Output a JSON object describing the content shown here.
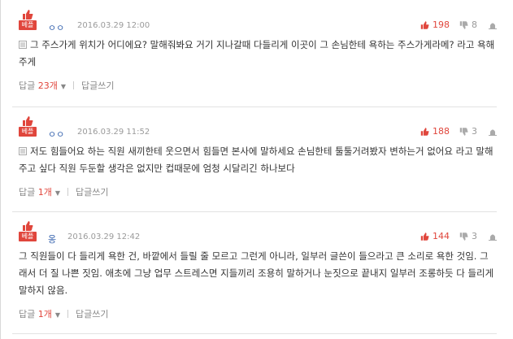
{
  "comments": [
    {
      "badge": "베플",
      "author": "ㅇㅇ",
      "date": "2016.03.29 12:00",
      "up": "198",
      "down": "8",
      "text": "그 주스가게 위치가 어디에요? 말해줘봐요 거기 지나갈때 다들리게 이곳이 그 손님한테 욕하는 주스가게라메? 라고 욕해주게",
      "reply_label": "답글",
      "reply_count": "23개",
      "write_label": "답글쓰기"
    },
    {
      "badge": "베플",
      "author": "ㅇㅇ",
      "date": "2016.03.29 11:52",
      "up": "188",
      "down": "3",
      "text": "저도 힘들어요 하는 직원 새끼한테 웃으면서 힘들면 본사에 말하세요 손님한테 툴툴거려봤자 변하는거 없어요 라고 말해주고 싶다 직원 두둔할 생각은 없지만 컵때문에 엄청 시달리긴 하나보다",
      "reply_label": "답글",
      "reply_count": "1개",
      "write_label": "답글쓰기"
    },
    {
      "badge": "베플",
      "author": "옹",
      "date": "2016.03.29 12:42",
      "up": "144",
      "down": "3",
      "text": "그 직원들이 다 들리게 욕한 건, 바깥에서 들릴 줄 모르고 그런게 아니라, 일부러 글쓴이 들으라고 큰 소리로 욕한 것임. 그래서 더 질 나쁜 짓임. 애초에 그냥 업무 스트레스면 지들끼리 조용히 말하거나 눈짓으로 끝내지 일부러 조롱하듯 다 들리게 말하지 않음.",
      "reply_label": "답글",
      "reply_count": "1개",
      "write_label": "답글쓰기"
    }
  ],
  "colors": {
    "accent": "#e0463c",
    "author": "#3b67b0",
    "muted": "#999999"
  },
  "icons": {
    "best": "thumbs-up-icon",
    "up": "thumbs-up-icon",
    "down": "thumbs-down-icon",
    "report": "siren-icon",
    "doc": "document-icon"
  }
}
